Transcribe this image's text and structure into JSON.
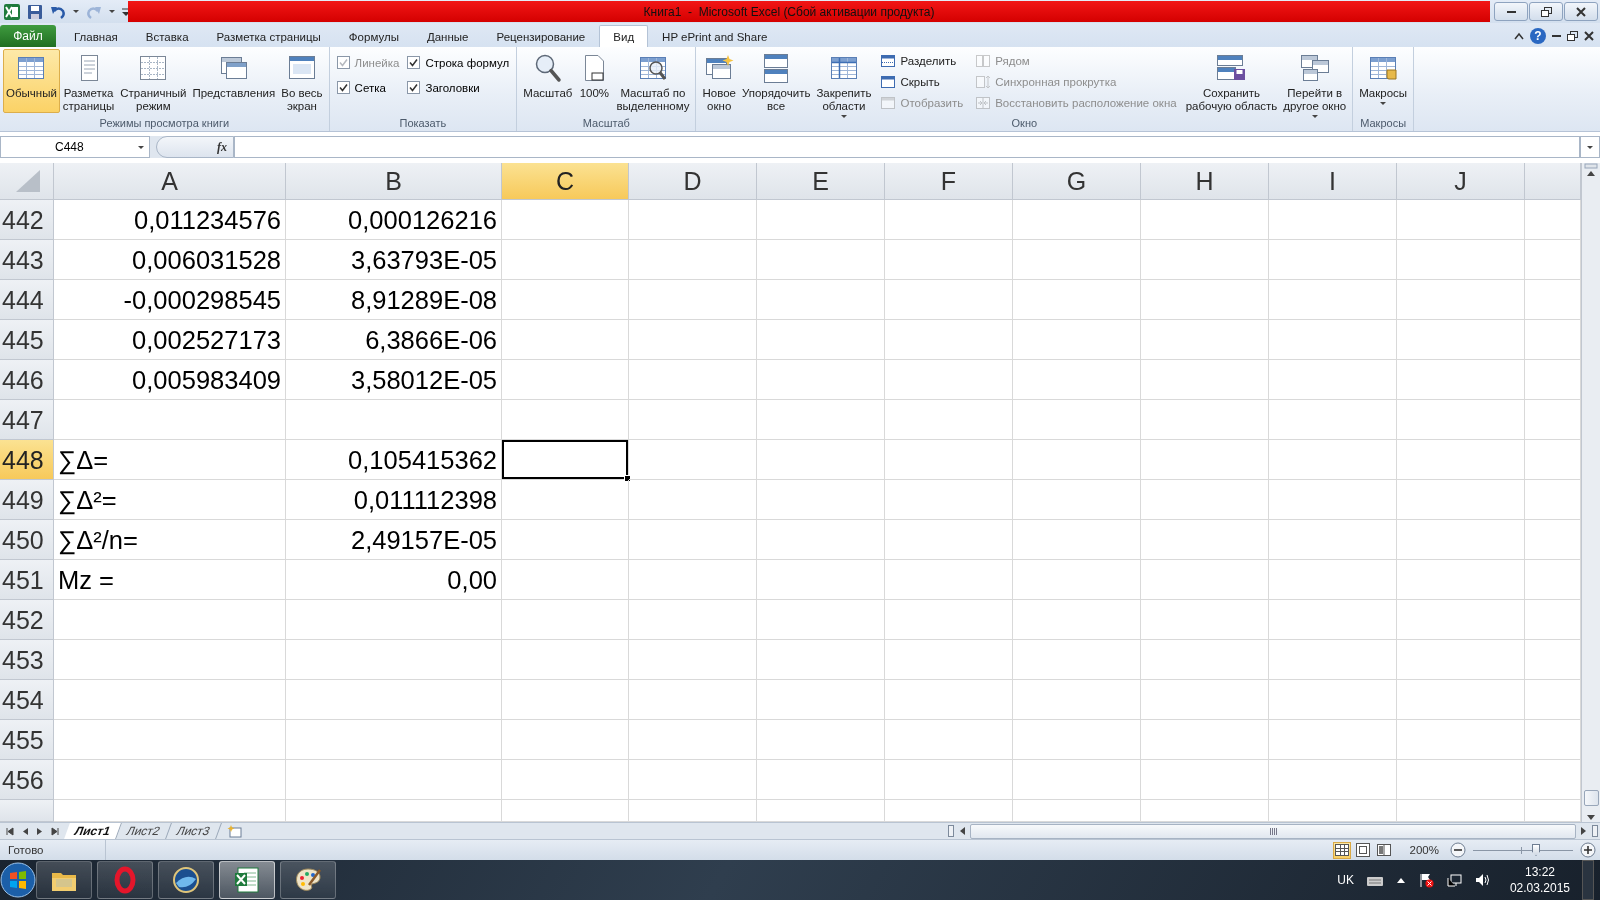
{
  "title_bar": {
    "quick_access": [
      {
        "disabled": false
      },
      {
        "disabled": false
      },
      {
        "disabled": true
      }
    ],
    "title": "Книга1  -  Microsoft Excel (Сбой активации продукта)"
  },
  "ribbon_tabs": [
    {
      "label": "Файл",
      "kind": "file",
      "selected": false
    },
    {
      "label": "Главная",
      "kind": "tab",
      "selected": false
    },
    {
      "label": "Вставка",
      "kind": "tab",
      "selected": false
    },
    {
      "label": "Разметка страницы",
      "kind": "tab",
      "selected": false
    },
    {
      "label": "Формулы",
      "kind": "tab",
      "selected": false
    },
    {
      "label": "Данные",
      "kind": "tab",
      "selected": false
    },
    {
      "label": "Рецензирование",
      "kind": "tab",
      "selected": false
    },
    {
      "label": "Вид",
      "kind": "tab",
      "selected": true
    },
    {
      "label": "HP ePrint and Share",
      "kind": "tab",
      "selected": false
    }
  ],
  "help_button": "?",
  "ribbon_groups": [
    {
      "label": "Режимы просмотра книги",
      "items": [
        {
          "kind": "large",
          "label": "Обычный",
          "selected": true,
          "dropdown": false,
          "disabled": false
        },
        {
          "kind": "large",
          "label": "Разметка\nстраницы",
          "selected": false,
          "dropdown": false,
          "disabled": false
        },
        {
          "kind": "large",
          "label": "Страничный\nрежим",
          "selected": false,
          "dropdown": false,
          "disabled": false
        },
        {
          "kind": "large",
          "label": "Представления",
          "selected": false,
          "dropdown": false,
          "disabled": false
        },
        {
          "kind": "large",
          "label": "Во весь\nэкран",
          "selected": false,
          "dropdown": false,
          "disabled": false
        }
      ]
    },
    {
      "label": "Показать",
      "items": [
        {
          "kind": "check",
          "label": "Линейка",
          "checked": true,
          "disabled": true
        },
        {
          "kind": "check",
          "label": "Сетка",
          "checked": true,
          "disabled": false
        },
        {
          "kind": "check",
          "label": "Строка формул",
          "checked": true,
          "disabled": false
        },
        {
          "kind": "check",
          "label": "Заголовки",
          "checked": true,
          "disabled": false
        }
      ]
    },
    {
      "label": "Масштаб",
      "items": [
        {
          "kind": "large",
          "label": "Масштаб",
          "dropdown": false,
          "disabled": false
        },
        {
          "kind": "large",
          "label": "100%",
          "dropdown": false,
          "disabled": false
        },
        {
          "kind": "large",
          "label": "Масштаб по\nвыделенному",
          "dropdown": false,
          "disabled": false
        }
      ]
    },
    {
      "label": "Окно",
      "items": [
        {
          "kind": "large",
          "label": "Новое\nокно",
          "dropdown": false,
          "disabled": false
        },
        {
          "kind": "large",
          "label": "Упорядочить\nвсе",
          "dropdown": false,
          "disabled": false
        },
        {
          "kind": "large",
          "label": "Закрепить\nобласти",
          "dropdown": true,
          "disabled": false
        },
        {
          "kind": "small",
          "label": "Разделить",
          "disabled": false
        },
        {
          "kind": "small",
          "label": "Скрыть",
          "disabled": false
        },
        {
          "kind": "small",
          "label": "Отобразить",
          "disabled": true
        },
        {
          "kind": "small",
          "label": "Рядом",
          "disabled": true
        },
        {
          "kind": "small",
          "label": "Синхронная прокрутка",
          "disabled": true
        },
        {
          "kind": "small",
          "label": "Восстановить расположение окна",
          "disabled": true
        },
        {
          "kind": "large",
          "label": "Сохранить\nрабочую область",
          "dropdown": false,
          "disabled": false
        },
        {
          "kind": "large",
          "label": "Перейти в\nдругое окно",
          "dropdown": true,
          "disabled": false
        }
      ]
    },
    {
      "label": "Макросы",
      "items": [
        {
          "kind": "large",
          "label": "Макросы\n",
          "dropdown": true,
          "disabled": false
        }
      ]
    }
  ],
  "formula_bar": {
    "name_box": "C448",
    "function_label": "fx"
  },
  "sheet": {
    "columns": [
      {
        "label": "A",
        "selected": false
      },
      {
        "label": "B",
        "selected": false
      },
      {
        "label": "C",
        "selected": true
      },
      {
        "label": "D",
        "selected": false
      },
      {
        "label": "E",
        "selected": false
      },
      {
        "label": "F",
        "selected": false
      },
      {
        "label": "G",
        "selected": false
      },
      {
        "label": "H",
        "selected": false
      },
      {
        "label": "I",
        "selected": false
      },
      {
        "label": "J",
        "selected": false
      }
    ],
    "rows": [
      {
        "number": "442",
        "selected": false,
        "cells": [
          {
            "text": "0,011234576",
            "kind": "number"
          },
          {
            "text": "0,000126216",
            "kind": "number"
          }
        ]
      },
      {
        "number": "443",
        "selected": false,
        "cells": [
          {
            "text": "0,006031528",
            "kind": "number"
          },
          {
            "text": "3,63793E-05",
            "kind": "number"
          }
        ]
      },
      {
        "number": "444",
        "selected": false,
        "cells": [
          {
            "text": "-0,000298545",
            "kind": "number"
          },
          {
            "text": "8,91289E-08",
            "kind": "number"
          }
        ]
      },
      {
        "number": "445",
        "selected": false,
        "cells": [
          {
            "text": "0,002527173",
            "kind": "number"
          },
          {
            "text": "6,3866E-06",
            "kind": "number"
          }
        ]
      },
      {
        "number": "446",
        "selected": false,
        "cells": [
          {
            "text": "0,005983409",
            "kind": "number"
          },
          {
            "text": "3,58012E-05",
            "kind": "number"
          }
        ]
      },
      {
        "number": "447",
        "selected": false
      },
      {
        "number": "448",
        "selected": true,
        "cells": [
          {
            "text": "∑Δ=",
            "kind": "text"
          },
          {
            "text": "0,105415362",
            "kind": "number"
          }
        ]
      },
      {
        "number": "449",
        "selected": false,
        "cells": [
          {
            "text": "∑Δ²=",
            "kind": "text"
          },
          {
            "text": "0,011112398",
            "kind": "number"
          }
        ]
      },
      {
        "number": "450",
        "selected": false,
        "cells": [
          {
            "text": "∑Δ²/n=",
            "kind": "text"
          },
          {
            "text": "2,49157E-05",
            "kind": "number"
          }
        ]
      },
      {
        "number": "451",
        "selected": false,
        "cells": [
          {
            "text": "Mz =",
            "kind": "text"
          },
          {
            "text": "0,00",
            "kind": "number"
          }
        ]
      },
      {
        "number": "452",
        "selected": false
      },
      {
        "number": "453",
        "selected": false
      },
      {
        "number": "454",
        "selected": false
      },
      {
        "number": "455",
        "selected": false
      },
      {
        "number": "456",
        "selected": false
      },
      {
        "selected": false
      }
    ]
  },
  "sheet_tabs": [
    {
      "label": "Лист1",
      "selected": true
    },
    {
      "label": "Лист2",
      "selected": false
    },
    {
      "label": "Лист3",
      "selected": false
    }
  ],
  "status_bar": {
    "status": "Готово",
    "views": [
      {
        "selected": true
      },
      {
        "selected": false
      },
      {
        "selected": false
      }
    ],
    "zoom": "200%",
    "zoom_slider": {
      "level": 0.63
    }
  },
  "taskbar": {
    "apps": [
      {
        "selected": false
      },
      {
        "selected": false
      },
      {
        "selected": false
      },
      {
        "selected": true
      },
      {
        "selected": false
      }
    ],
    "language": "UK",
    "time": "13:22",
    "date": "02.03.2015"
  }
}
